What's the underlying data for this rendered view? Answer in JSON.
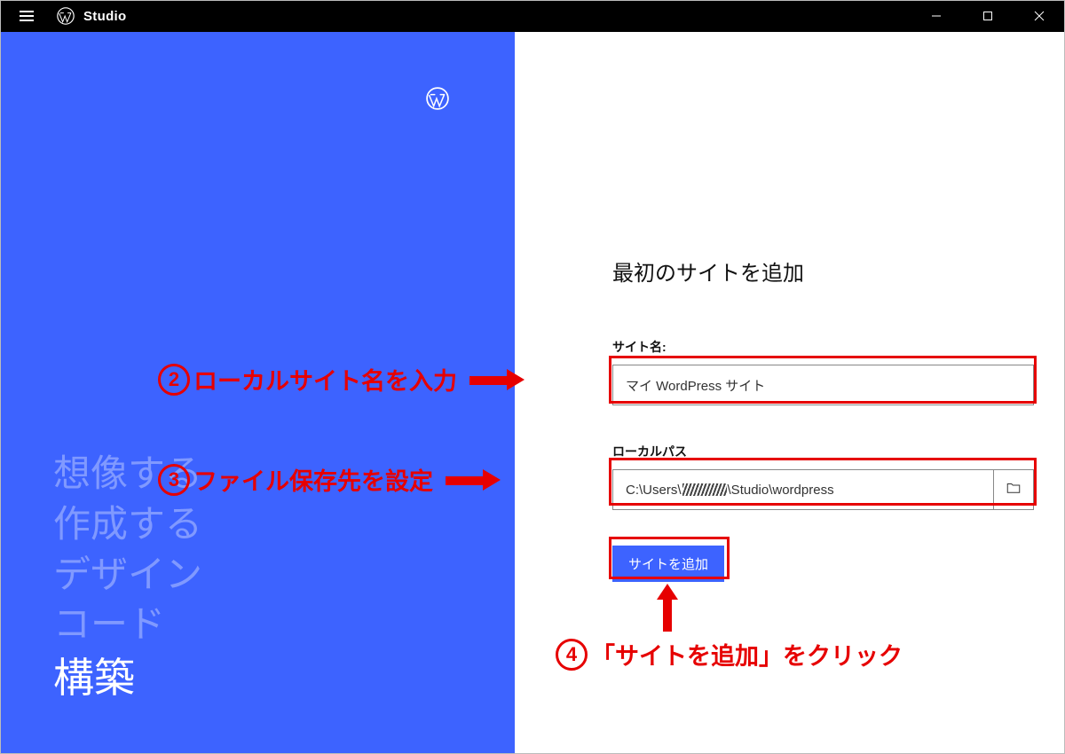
{
  "app": {
    "title": "Studio"
  },
  "left": {
    "words": [
      "想像する",
      "作成する",
      "デザイン",
      "コード",
      "構築"
    ],
    "active_index": 4
  },
  "form": {
    "heading": "最初のサイトを追加",
    "site_name_label": "サイト名:",
    "site_name_value": "マイ WordPress サイト",
    "local_path_label": "ローカルパス",
    "local_path_prefix": "C:\\Users\\",
    "local_path_suffix": "\\Studio\\wordpress",
    "add_button_label": "サイトを追加"
  },
  "annotations": {
    "step2": "ローカルサイト名を入力",
    "step3": "ファイル保存先を設定",
    "step4": "「サイトを追加」をクリック",
    "num2": "2",
    "num3": "3",
    "num4": "4"
  }
}
